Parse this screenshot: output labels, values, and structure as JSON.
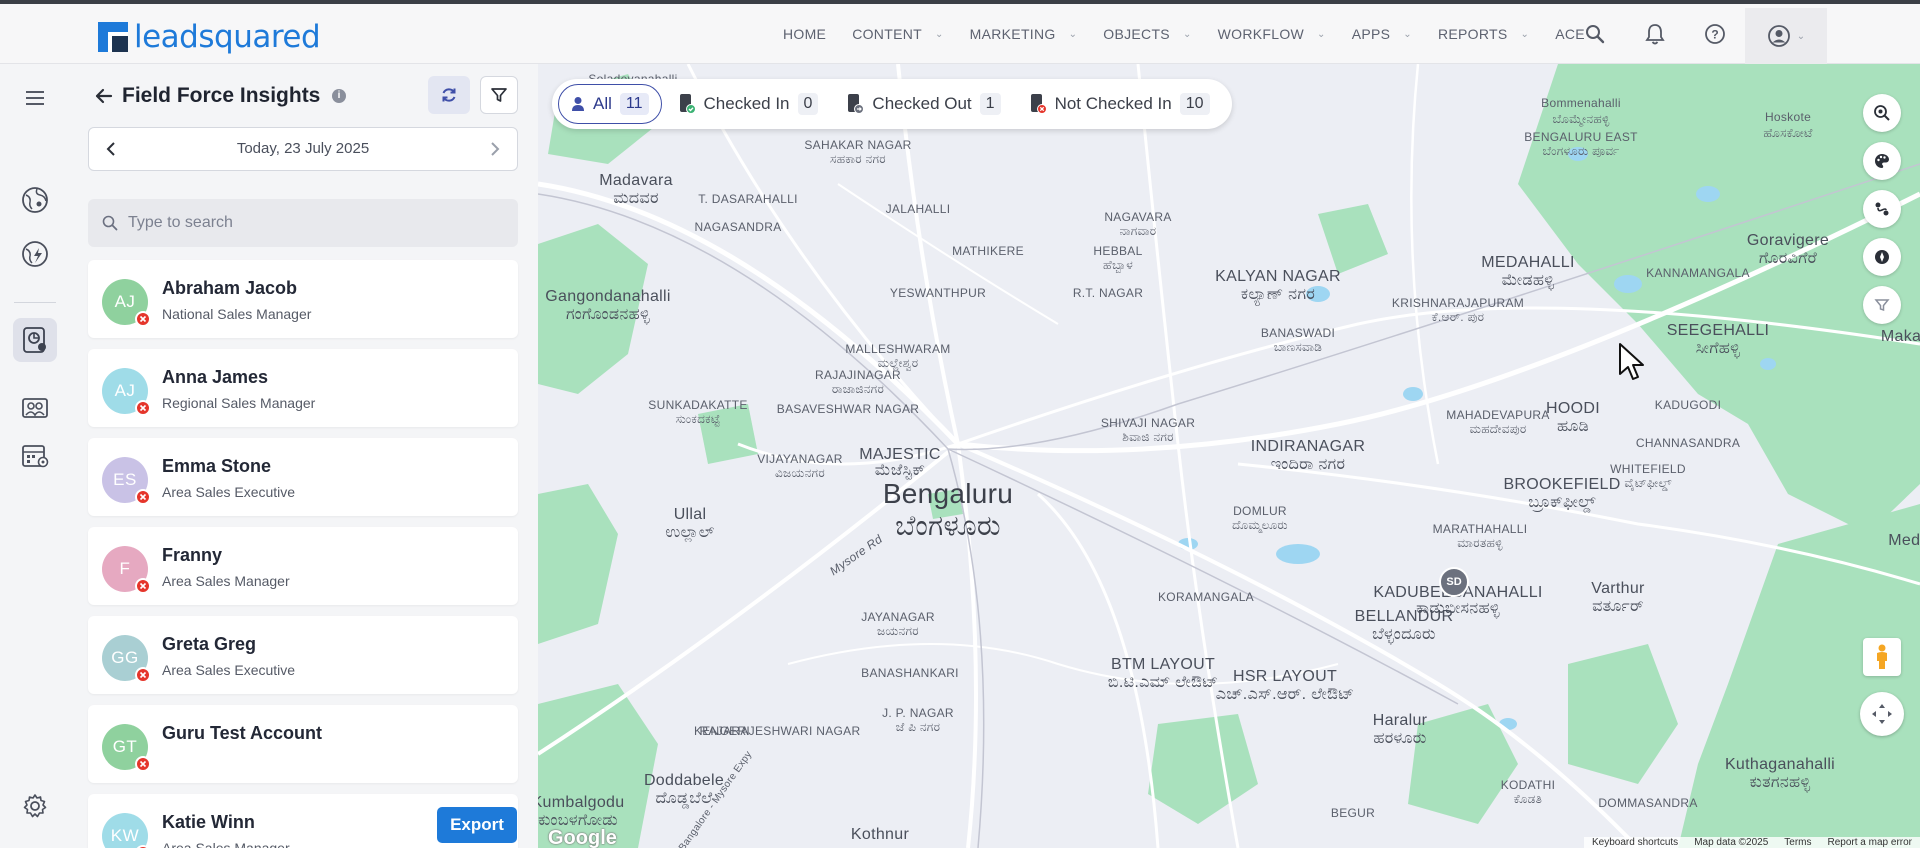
{
  "brand": {
    "logo_text": "leadsquared"
  },
  "nav": {
    "items": [
      {
        "label": "HOME",
        "dropdown": false
      },
      {
        "label": "CONTENT",
        "dropdown": true
      },
      {
        "label": "MARKETING",
        "dropdown": true
      },
      {
        "label": "OBJECTS",
        "dropdown": true
      },
      {
        "label": "WORKFLOW",
        "dropdown": true
      },
      {
        "label": "APPS",
        "dropdown": true
      },
      {
        "label": "REPORTS",
        "dropdown": true
      },
      {
        "label": "ACE",
        "dropdown": false
      }
    ],
    "icons": [
      "search-icon",
      "bell-icon",
      "help-icon",
      "profile-icon"
    ]
  },
  "rail": {
    "icons": [
      "menu-icon",
      "globe-people-icon",
      "globe-lightning-icon",
      "field-force-icon",
      "team-map-icon",
      "calendar-location-icon",
      "settings-icon"
    ],
    "active": "field-force-icon"
  },
  "panel": {
    "title": "Field Force Insights",
    "date_label": "Today, 23 July 2025",
    "search_placeholder": "Type to search",
    "export_label": "Export",
    "users": [
      {
        "initials": "AJ",
        "name": "Abraham Jacob",
        "role": "National Sales Manager",
        "color": "#8fd19e"
      },
      {
        "initials": "AJ",
        "name": "Anna James",
        "role": "Regional Sales Manager",
        "color": "#9fdce8"
      },
      {
        "initials": "ES",
        "name": "Emma Stone",
        "role": "Area Sales Executive",
        "color": "#c9c2e6"
      },
      {
        "initials": "F",
        "name": "Franny",
        "role": "Area Sales Manager",
        "color": "#e6a9c1"
      },
      {
        "initials": "GG",
        "name": "Greta Greg",
        "role": "Area Sales Executive",
        "color": "#a9cfd3"
      },
      {
        "initials": "GT",
        "name": "Guru Test Account",
        "role": "",
        "color": "#8fd19e"
      },
      {
        "initials": "KW",
        "name": "Katie Winn",
        "role": "Area Sales Manager",
        "color": "#9fdce8"
      }
    ]
  },
  "status_filters": [
    {
      "label": "All",
      "count": "11",
      "icon": "user-icon",
      "active": true
    },
    {
      "label": "Checked In",
      "count": "0",
      "icon": "phone-check-icon",
      "active": false
    },
    {
      "label": "Checked Out",
      "count": "1",
      "icon": "phone-out-icon",
      "active": false
    },
    {
      "label": "Not Checked In",
      "count": "10",
      "icon": "phone-x-icon",
      "active": false
    }
  ],
  "map": {
    "marker_label": "SD",
    "google_label": "Google",
    "attribution": [
      "Keyboard shortcuts",
      "Map data ©2025",
      "Terms",
      "Report a map error"
    ],
    "labels": [
      {
        "t": "Soladevanahalli"
      },
      {
        "t": "Bommenahalli"
      },
      {
        "t": "ಬೊಮ್ಮೇನಹಳ್ಳಿ"
      },
      {
        "t": "BENGALURU EAST"
      },
      {
        "t": "ಬೆಂಗಳೂರು ಪೂರ್ವ"
      },
      {
        "t": "Hoskote"
      },
      {
        "t": "ಹೊಸಕೋಟೆ"
      },
      {
        "t": "SAHAKAR NAGAR"
      },
      {
        "t": "ಸಹಕಾರ ನಗರ"
      },
      {
        "t": "Madavara"
      },
      {
        "t": "ಮದವರ"
      },
      {
        "t": "T. DASARAHALLI"
      },
      {
        "t": "JALAHALLI"
      },
      {
        "t": "NAGASANDRA"
      },
      {
        "t": "NAGAVARA"
      },
      {
        "t": "ನಾಗವಾರ"
      },
      {
        "t": "Goravigere"
      },
      {
        "t": "ಗೊರವಿಗೆರೆ"
      },
      {
        "t": "MATHIKERE"
      },
      {
        "t": "HEBBAL"
      },
      {
        "t": "ಹೆಬ್ಬಾಳ"
      },
      {
        "t": "MEDAHALLI"
      },
      {
        "t": "ಮೇಡಹಳ್ಳಿ"
      },
      {
        "t": "YESWANTHPUR"
      },
      {
        "t": "R.T. NAGAR"
      },
      {
        "t": "KALYAN NAGAR"
      },
      {
        "t": "ಕಲ್ಯಾಣ್ ನಗರ"
      },
      {
        "t": "KANNAMANGALA"
      },
      {
        "t": "Gangondanahalli"
      },
      {
        "t": "ಗಂಗೊಂಡನಹಳ್ಳಿ"
      },
      {
        "t": "KRISHNARAJAPURAM"
      },
      {
        "t": "ಕೆ.ಆರ್. ಪುರ"
      },
      {
        "t": "SEEGEHALLI"
      },
      {
        "t": "ಸೀಗೆಹಳ್ಳಿ"
      },
      {
        "t": "BANASWADI"
      },
      {
        "t": "ಬಾಣಸವಾಡಿ"
      },
      {
        "t": "MALLESHWARAM"
      },
      {
        "t": "ಮಲ್ಲೇಶ್ವರ"
      },
      {
        "t": "RAJAJINAGAR"
      },
      {
        "t": "ರಾಜಾಜಿನಗರ"
      },
      {
        "t": "SUNKADAKATTE"
      },
      {
        "t": "ಸುಂಕದಕಟ್ಟೆ"
      },
      {
        "t": "BASAVESHWAR NAGAR"
      },
      {
        "t": "MAHADEVAPURA"
      },
      {
        "t": "ಮಹದೇವಪುರ"
      },
      {
        "t": "HOODI"
      },
      {
        "t": "ಹೂಡಿ"
      },
      {
        "t": "KADUGODI"
      },
      {
        "t": "SHIVAJI NAGAR"
      },
      {
        "t": "ಶಿವಾಜಿ ನಗರ"
      },
      {
        "t": "CHANNASANDRA"
      },
      {
        "t": "MAJESTIC"
      },
      {
        "t": "ಮೆಜೆಸ್ಟಿಕ್"
      },
      {
        "t": "VIJAYANAGAR"
      },
      {
        "t": "ವಿಜಯನಗರ"
      },
      {
        "t": "INDIRANAGAR"
      },
      {
        "t": "ಇಂದಿರಾ ನಗರ"
      },
      {
        "t": "WHITEFIELD"
      },
      {
        "t": "ವೈಟ್‌ಫೀಲ್ಡ್"
      },
      {
        "t": "Bengaluru"
      },
      {
        "t": "ಬೆಂಗಳೂರು"
      },
      {
        "t": "BROOKEFIELD"
      },
      {
        "t": "ಬ್ರೂಕ್‌ಫೀಲ್ಡ್"
      },
      {
        "t": "Ullal"
      },
      {
        "t": "ಉಲ್ಲಾಲ್"
      },
      {
        "t": "DOMLUR"
      },
      {
        "t": "ದೊಮ್ಮಲೂರು"
      },
      {
        "t": "MARATHAHALLI"
      },
      {
        "t": "ಮಾರತಹಳ್ಳಿ"
      },
      {
        "t": "Medim"
      },
      {
        "t": "KADUBEESANAHALLI"
      },
      {
        "t": "ಕಾಡುಬೀಸನಹಳ್ಳಿ"
      },
      {
        "t": "Varthur"
      },
      {
        "t": "ವರ್ತೂರ್"
      },
      {
        "t": "BELLANDUR"
      },
      {
        "t": "ಬೆಳ್ಳಂದೂರು"
      },
      {
        "t": "KORAMANGALA"
      },
      {
        "t": "JAYANAGAR"
      },
      {
        "t": "ಜಯನಗರ"
      },
      {
        "t": "BANASHANKARI"
      },
      {
        "t": "RAJARAJESHWARI NAGAR"
      },
      {
        "t": "BTM LAYOUT"
      },
      {
        "t": "ಬಿ.ಟಿ.ಎಮ್ ಲೇಔಟ್"
      },
      {
        "t": "HSR LAYOUT"
      },
      {
        "t": "ಎಚ್.ಎಸ್.ಆರ್. ಲೇಔಟ್"
      },
      {
        "t": "J. P. NAGAR"
      },
      {
        "t": "ಜೆ ಪಿ ನಗರ"
      },
      {
        "t": "KENGERI"
      },
      {
        "t": "Haralur"
      },
      {
        "t": "ಹರಳೂರು"
      },
      {
        "t": "Doddabele"
      },
      {
        "t": "ದೊಡ್ಡಬೆಲೆ"
      },
      {
        "t": "KODATHI"
      },
      {
        "t": "ಕೊಡತಿ"
      },
      {
        "t": "Kuthaganahalli"
      },
      {
        "t": "ಕುತಗನಹಳ್ಳಿ"
      },
      {
        "t": "Kumbalgodu"
      },
      {
        "t": "ಕುಂಬಳಗೋಡು"
      },
      {
        "t": "DOMMASANDRA"
      },
      {
        "t": "BEGUR"
      },
      {
        "t": "Kothnur"
      },
      {
        "t": "Makal"
      },
      {
        "t": "Mysore Rd"
      },
      {
        "t": "NICE Bangalore - Mysore Expy"
      }
    ]
  }
}
